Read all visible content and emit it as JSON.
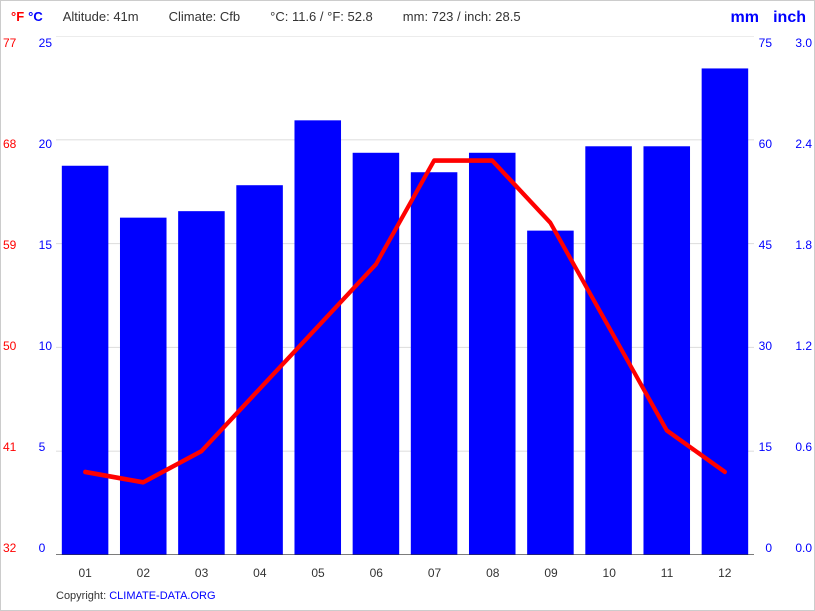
{
  "header": {
    "fahrenheit_label": "°F",
    "celsius_label": "°C",
    "altitude": "Altitude: 41m",
    "climate": "Climate: Cfb",
    "temp_stats": "°C: 11.6 / °F: 52.8",
    "precip_stats": "mm: 723 / inch: 28.5",
    "mm_label": "mm",
    "inch_label": "inch"
  },
  "y_axis_left_fahrenheit": [
    "77",
    "68",
    "59",
    "50",
    "41",
    "32"
  ],
  "y_axis_left_celsius": [
    "25",
    "20",
    "15",
    "10",
    "5",
    "0"
  ],
  "y_axis_right_mm": [
    "75",
    "60",
    "45",
    "30",
    "15",
    "0"
  ],
  "y_axis_right_inch": [
    "3.0",
    "2.4",
    "1.8",
    "1.2",
    "0.6",
    "0.0"
  ],
  "x_labels": [
    "01",
    "02",
    "03",
    "04",
    "05",
    "06",
    "07",
    "08",
    "09",
    "10",
    "11",
    "12"
  ],
  "bar_data": [
    {
      "month": "01",
      "mm": 60
    },
    {
      "month": "02",
      "mm": 52
    },
    {
      "month": "03",
      "mm": 53
    },
    {
      "month": "04",
      "mm": 57
    },
    {
      "month": "05",
      "mm": 67
    },
    {
      "month": "06",
      "mm": 62
    },
    {
      "month": "07",
      "mm": 59
    },
    {
      "month": "08",
      "mm": 62
    },
    {
      "month": "09",
      "mm": 50
    },
    {
      "month": "10",
      "mm": 63
    },
    {
      "month": "11",
      "mm": 63
    },
    {
      "month": "12",
      "mm": 75
    }
  ],
  "temp_line_data": [
    {
      "month": "01",
      "temp": 4
    },
    {
      "month": "02",
      "temp": 3.5
    },
    {
      "month": "03",
      "temp": 5
    },
    {
      "month": "04",
      "temp": 8
    },
    {
      "month": "05",
      "temp": 11
    },
    {
      "month": "06",
      "temp": 14
    },
    {
      "month": "07",
      "temp": 19
    },
    {
      "month": "08",
      "temp": 19
    },
    {
      "month": "09",
      "temp": 16
    },
    {
      "month": "10",
      "temp": 11
    },
    {
      "month": "11",
      "temp": 6
    },
    {
      "month": "12",
      "temp": 4
    }
  ],
  "copyright_text": "Copyright: CLIMATE-DATA.ORG"
}
